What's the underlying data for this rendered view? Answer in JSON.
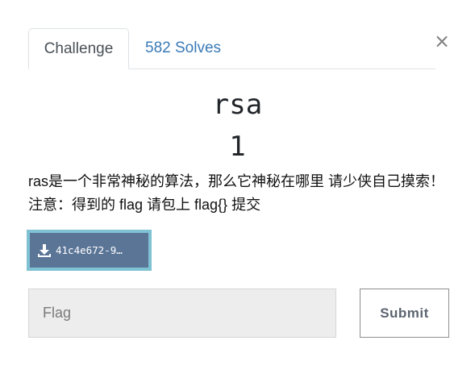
{
  "tabs": {
    "challenge_label": "Challenge",
    "solves_label": "582 Solves"
  },
  "close": {
    "glyph": "×",
    "icon": "close-icon"
  },
  "challenge": {
    "name": "rsa",
    "value": "1",
    "description": "ras是一个非常神秘的算法，那么它神秘在哪里 请少侠自己摸索！注意：得到的 flag 请包上 flag{} 提交"
  },
  "download": {
    "label": "41c4e672-9…",
    "icon": "download-icon"
  },
  "form": {
    "flag_placeholder": "Flag",
    "flag_value": "",
    "submit_label": "Submit"
  },
  "colors": {
    "tab_link": "#3a7ab7",
    "download_bg": "#5b7597",
    "download_border": "#7fc2d3",
    "input_bg": "#ededed"
  }
}
